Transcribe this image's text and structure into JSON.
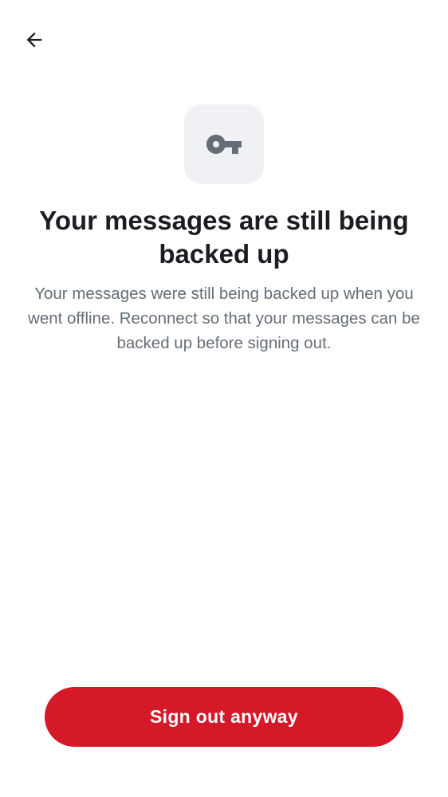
{
  "header": {
    "back_icon": "arrow-left-icon"
  },
  "illustration": {
    "icon": "key-icon",
    "tile_color": "#f0f1f4",
    "icon_color": "#656d77"
  },
  "content": {
    "title": "Your messages are still being backed up",
    "description": "Your messages were still being backed up when you went offline. Reconnect so that your messages can be backed up before signing out."
  },
  "actions": {
    "sign_out_label": "Sign out anyway",
    "sign_out_color": "#d51928"
  }
}
